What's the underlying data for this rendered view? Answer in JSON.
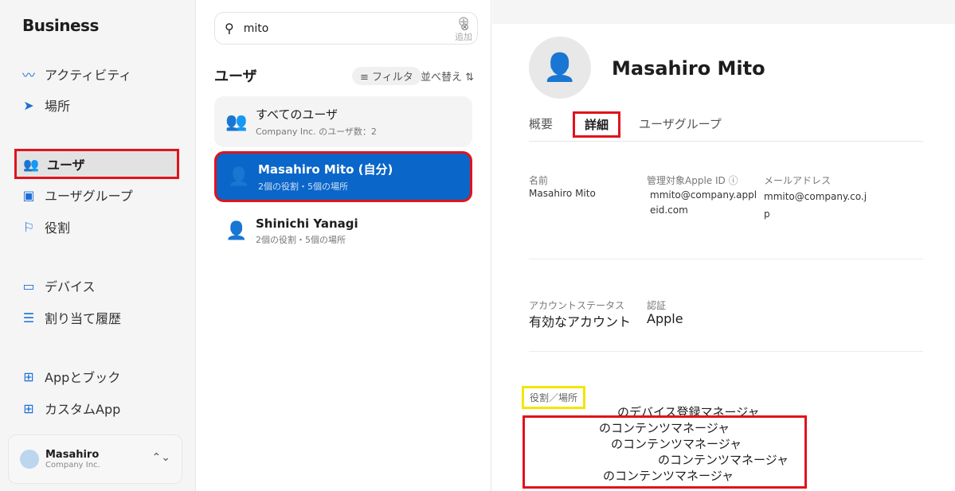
{
  "app": {
    "logo": "Business"
  },
  "sidebar": {
    "items": [
      {
        "label": "アクティビティ"
      },
      {
        "label": "場所"
      },
      {
        "label": "ユーザ"
      },
      {
        "label": "ユーザグループ"
      },
      {
        "label": "役割"
      },
      {
        "label": "デバイス"
      },
      {
        "label": "割り当て履歴"
      },
      {
        "label": "Appとブック"
      },
      {
        "label": "カスタムApp"
      }
    ],
    "account": {
      "name": "Masahiro",
      "org": "Company Inc."
    }
  },
  "middle": {
    "search_value": "mito",
    "add_label": "追加",
    "title": "ユーザ",
    "filter_label": "フィルタ",
    "sort_label": "並べ替え",
    "cards": [
      {
        "title": "すべてのユーザ",
        "subtitle": "Company Inc. のユーザ数：2"
      },
      {
        "title": "Masahiro Mito (自分)",
        "subtitle": "2個の役割・5個の場所"
      },
      {
        "title": "Shinichi Yanagi",
        "subtitle": "2個の役割・5個の場所"
      }
    ]
  },
  "detail": {
    "user_name": "Masahiro Mito",
    "tabs": [
      "概要",
      "詳細",
      "ユーザグループ"
    ],
    "name_label": "名前",
    "name_value": "Masahiro Mito",
    "apple_id_label": "管理対象Apple ID",
    "apple_id_value": "mmito@company.appleid.com",
    "email_label": "メールアドレス",
    "email_value": "mmito@company.co.jp",
    "status_label": "アカウントステータス",
    "status_value": "有効なアカウント",
    "auth_label": "認証",
    "auth_value": "Apple",
    "roles_label": "役割／場所",
    "roles": [
      "のデバイス登録マネージャ",
      "のコンテンツマネージャ",
      "のコンテンツマネージャ",
      "のコンテンツマネージャ",
      "のコンテンツマネージャ"
    ]
  }
}
